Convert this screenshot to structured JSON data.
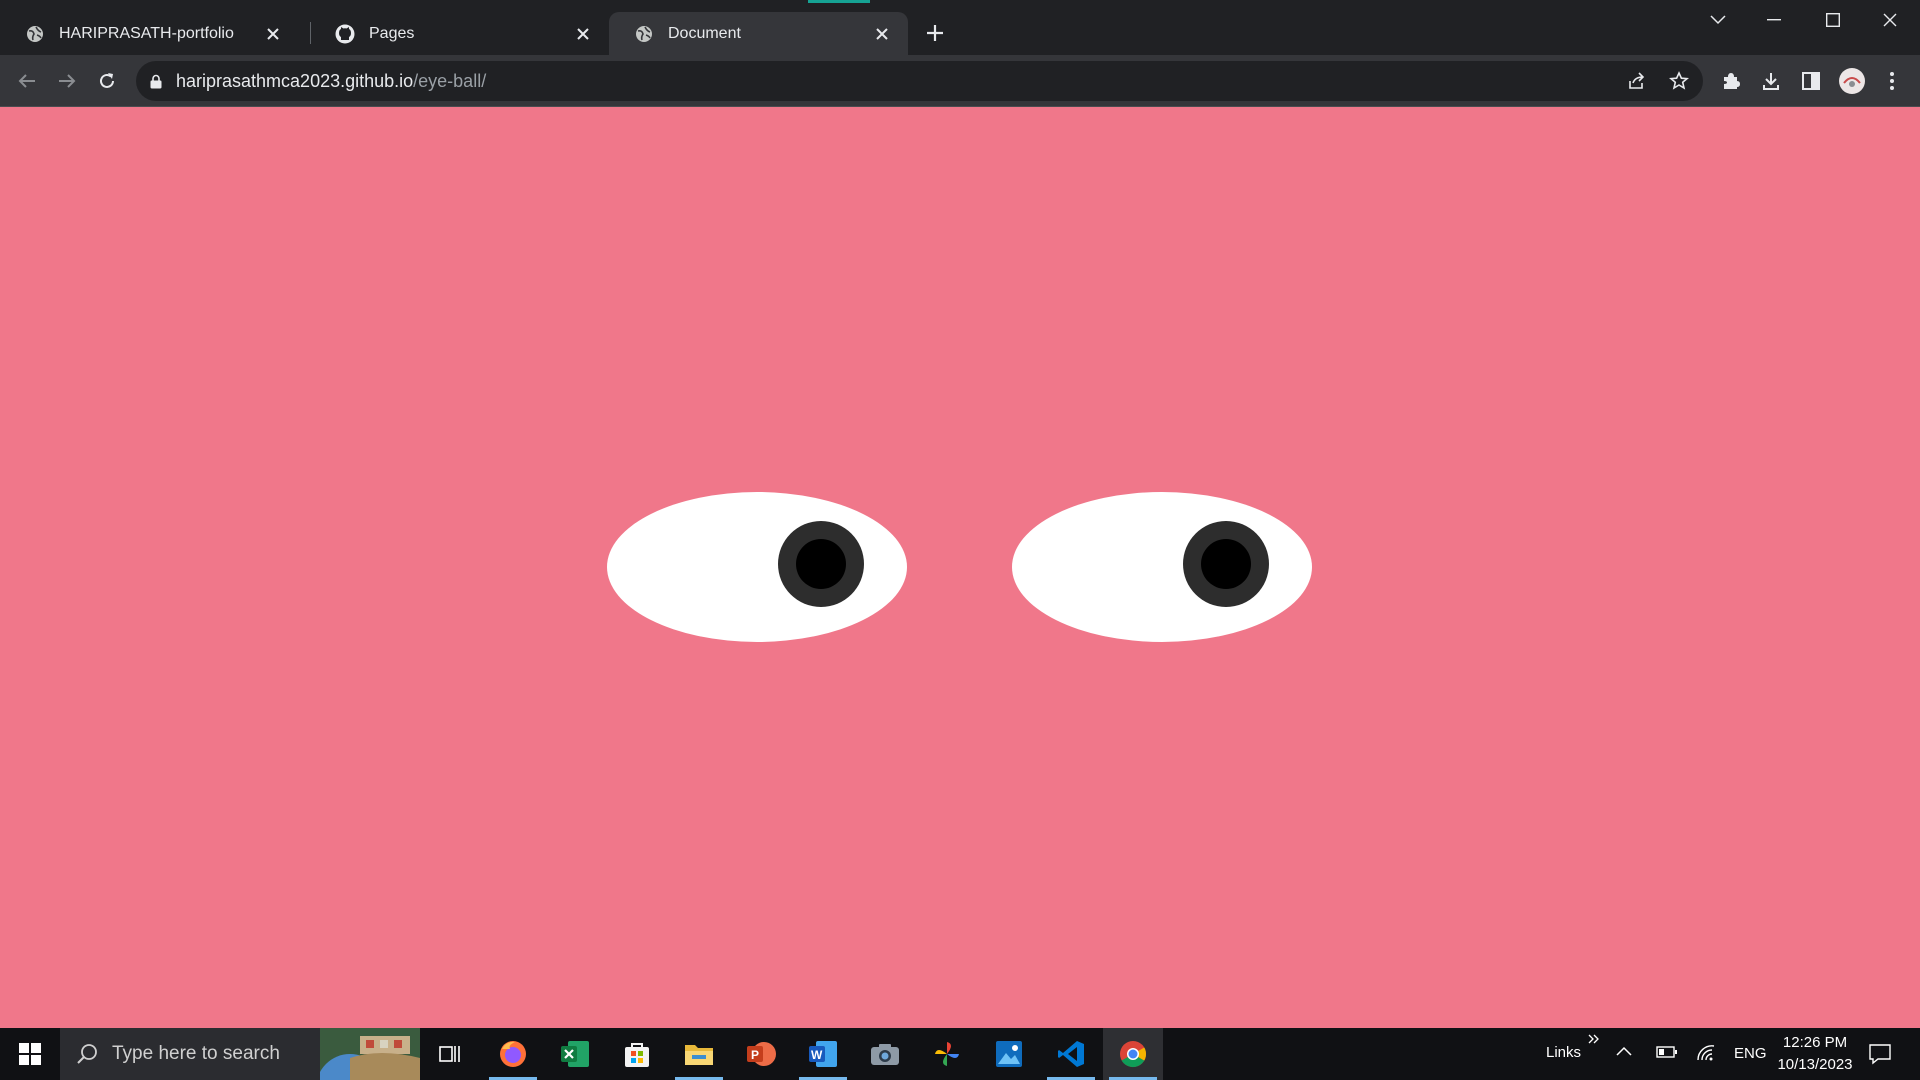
{
  "browser": {
    "tabs": [
      {
        "title": "HARIPRASATH-portfolio",
        "favicon": "globe-icon",
        "active": false
      },
      {
        "title": "Pages",
        "favicon": "github-icon",
        "active": false
      },
      {
        "title": "Document",
        "favicon": "globe-icon",
        "active": true
      }
    ],
    "address": {
      "host": "hariprasathmca2023.github.io",
      "path": "/eye-ball/"
    }
  },
  "page": {
    "background_color": "#f0778a"
  },
  "taskbar": {
    "search_placeholder": "Type here to search",
    "apps": [
      "firefox-icon",
      "excel-icon",
      "store-icon",
      "file-explorer-icon",
      "powerpoint-icon",
      "word-icon",
      "camera-icon",
      "pinwheel-icon",
      "photos-icon",
      "vscode-icon",
      "chrome-icon"
    ],
    "links_label": "Links",
    "language": "ENG",
    "time": "12:26 PM",
    "date": "10/13/2023"
  }
}
